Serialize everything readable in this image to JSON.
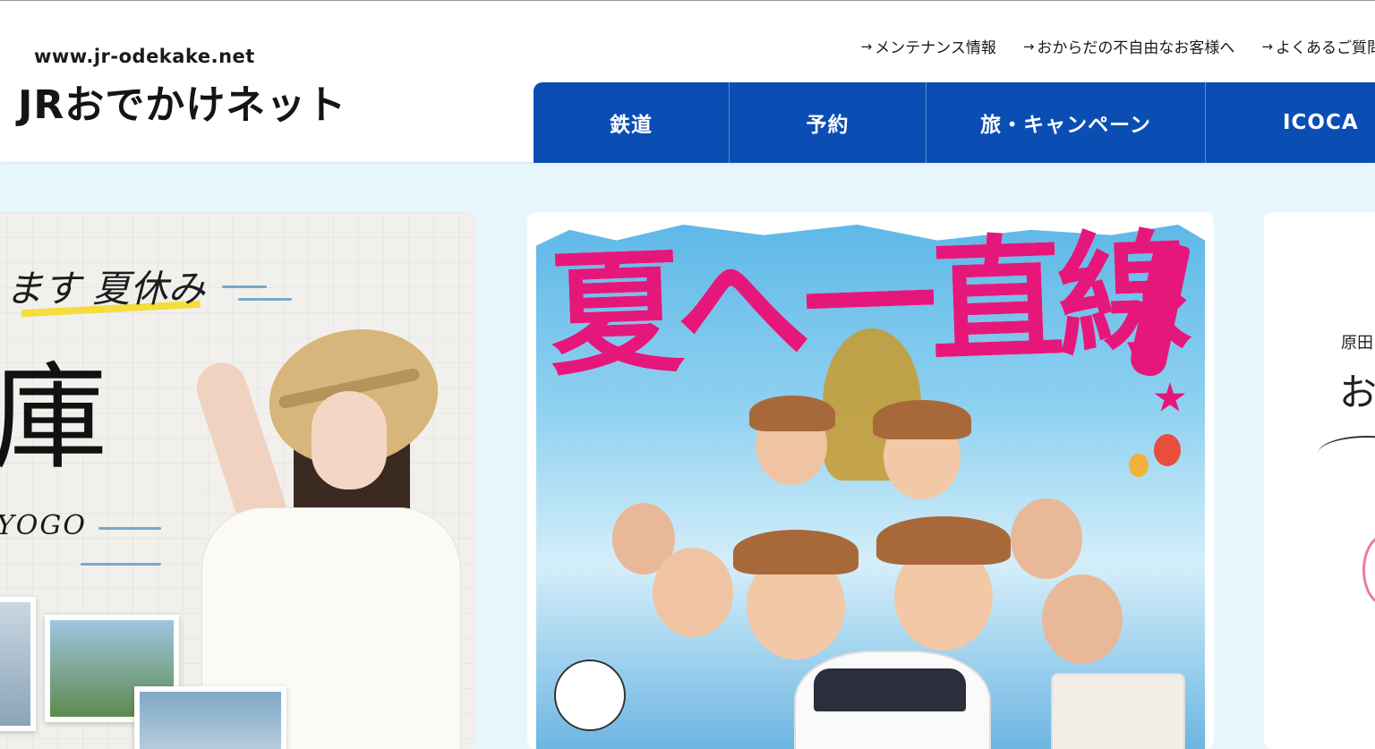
{
  "header": {
    "site_url": "www.jr-odekake.net",
    "logo_text": "JRおでかけネット",
    "util_links": [
      {
        "label": "メンテナンス情報"
      },
      {
        "label": "おからだの不自由なお客様へ"
      },
      {
        "label": "よくあるご質問"
      }
    ]
  },
  "nav": {
    "items": [
      {
        "label": "鉄道"
      },
      {
        "label": "予約"
      },
      {
        "label": "旅・キャンペーン"
      },
      {
        "label": "ICOCA"
      }
    ]
  },
  "carousel": {
    "left_card": {
      "headline": "ます 夏休み",
      "big_text": "庫",
      "sub_text": "YOGO"
    },
    "center_card": {
      "title": "夏へ一直線"
    },
    "right_card": {
      "line1": "原田",
      "line2": "お"
    }
  },
  "colors": {
    "nav_bg": "#0a4eb4",
    "page_bg": "#e8f6fd",
    "accent_pink": "#e5177b"
  }
}
